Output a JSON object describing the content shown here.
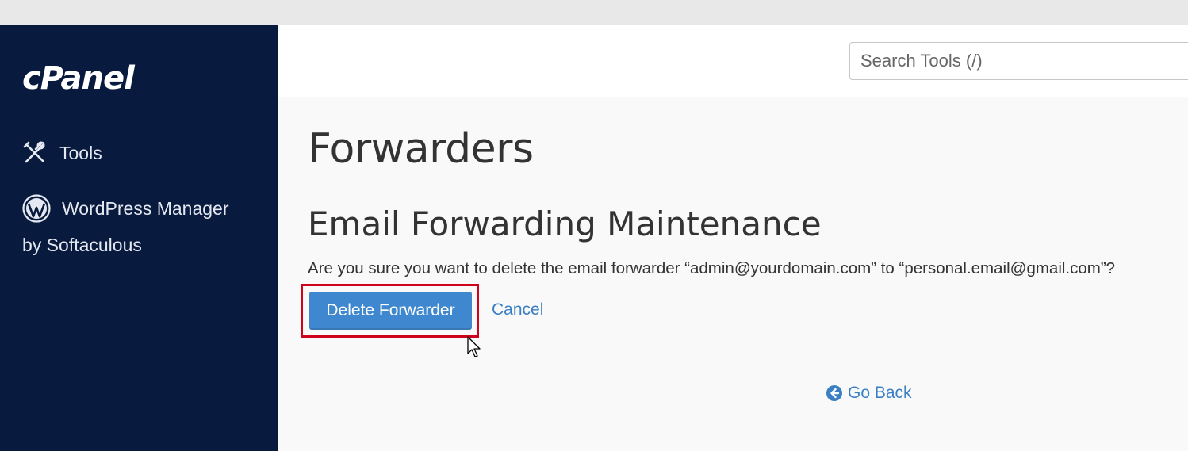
{
  "brand": {
    "logo_text": "cPanel"
  },
  "sidebar": {
    "items": [
      {
        "label": "Tools",
        "icon": "tools-icon"
      },
      {
        "label_line1": "WordPress Manager",
        "label_line2": "by Softaculous",
        "icon": "wordpress-icon"
      }
    ]
  },
  "header": {
    "search_placeholder": "Search Tools (/)"
  },
  "main": {
    "page_title": "Forwarders",
    "section_title": "Email Forwarding Maintenance",
    "confirm_text": "Are you sure you want to delete the email forwarder “admin@yourdomain.com” to “personal.email@gmail.com”?",
    "delete_label": "Delete Forwarder",
    "cancel_label": "Cancel",
    "goback_label": "Go Back"
  },
  "colors": {
    "sidebar_bg": "#091a3f",
    "primary_button": "#3f88cf",
    "link": "#3a7fc4",
    "highlight_border": "#d0021b"
  }
}
